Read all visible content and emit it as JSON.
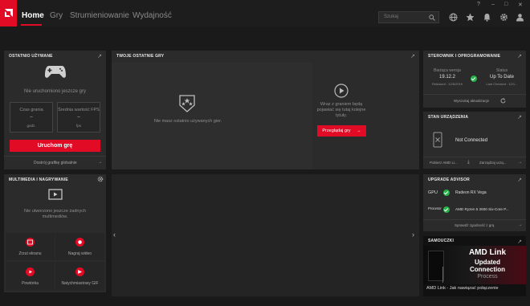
{
  "nav": {
    "tabs": [
      "Home",
      "Gry",
      "Strumieniowanie",
      "Wydajność"
    ],
    "search_placeholder": "Szukaj"
  },
  "window_controls": [
    "?",
    "–",
    "□",
    "✕"
  ],
  "recent_used": {
    "title": "OSTATNIO UŻYWANE",
    "message": "Nie uruchomiono jeszcze gry",
    "stats": [
      {
        "label": "Czas grania",
        "dash": "–",
        "unit": "godz."
      },
      {
        "label": "Średnia wartość FPS",
        "dash": "–",
        "unit": "fps"
      }
    ],
    "launch_button": "Uruchom grę",
    "footer": "Dostrój grafikę globalnie"
  },
  "recent_games": {
    "title": "TWOJE OSTATNIE GRY",
    "empty": "Nie masz ostatnio używanych gier.",
    "promo": "Wraz z graniem będą pojawiać się tutaj kolejne tytuły.",
    "browse_button": "Przeglądaj gry"
  },
  "drivers": {
    "title": "STEROWNIK I OPROGRAMOWANIE",
    "installed_label": "Bieżąca wersja",
    "installed_version": "19.12.2",
    "released": "Released : 12/6/2019",
    "status_label": "Status",
    "status_value": "Up To Date",
    "last_checked": "Last Checked : 12/1...",
    "check_updates": "Wyszukaj aktualizacje"
  },
  "device_status": {
    "title": "STAN URZĄDZENIA",
    "status": "Not Connected",
    "link1": "Pobierz AMD Li...",
    "link2": "Zarządzaj urzą..."
  },
  "media": {
    "title": "MULTIMEDIA I NAGRYWANIE",
    "empty": "Nie utworzono jeszcze żadnych multimediów.",
    "actions": [
      "Zrzut ekranu",
      "Nagraj wideo",
      "Powtórka",
      "Natychmiastowy GIF"
    ]
  },
  "upgrade": {
    "title": "UPGRADE ADVISOR",
    "rows": [
      {
        "label": "GPU",
        "value": "Radeon RX Vega"
      },
      {
        "label": "Procesor",
        "value": "AMD Ryzen 5 2600 Six-Core P..."
      }
    ],
    "footer": "Sprawdź zgodność z grą"
  },
  "tutorials": {
    "title": "SAMOUCZKI",
    "image_text": [
      "AMD Link",
      "Updated",
      "Connection",
      "Process"
    ],
    "caption": "AMD Link - Jak nawiązać połączenie"
  },
  "colors": {
    "accent": "#e10b26",
    "ok": "#27b14a"
  }
}
